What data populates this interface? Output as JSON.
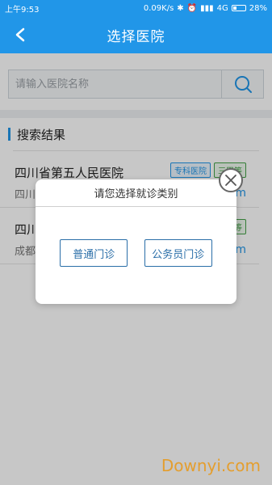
{
  "status_bar": {
    "time": "上午9:53",
    "net_speed": "0.09K/s",
    "network": "4G",
    "battery": "28%"
  },
  "nav": {
    "title": "选择医院",
    "back_icon": "chevron-left-icon"
  },
  "search": {
    "placeholder": "请输入医院名称",
    "icon": "search-icon"
  },
  "results": {
    "title": "搜索结果",
    "items": [
      {
        "name": "四川省第五人民医院",
        "sub": "四川",
        "tag_type": "专科医院",
        "tag_level": "三甲等",
        "distance": "km"
      },
      {
        "name": "四川",
        "sub": "成都",
        "tag_level": "甲等",
        "distance": "km"
      }
    ]
  },
  "dialog": {
    "title": "请您选择就诊类别",
    "options": [
      "普通门诊",
      "公务员门诊"
    ],
    "close_icon": "close-icon"
  },
  "watermark": "Downyi.com",
  "colors": {
    "primary": "#2196e8",
    "dialog_button": "#2a6ea8",
    "watermark": "#e89a1e"
  }
}
